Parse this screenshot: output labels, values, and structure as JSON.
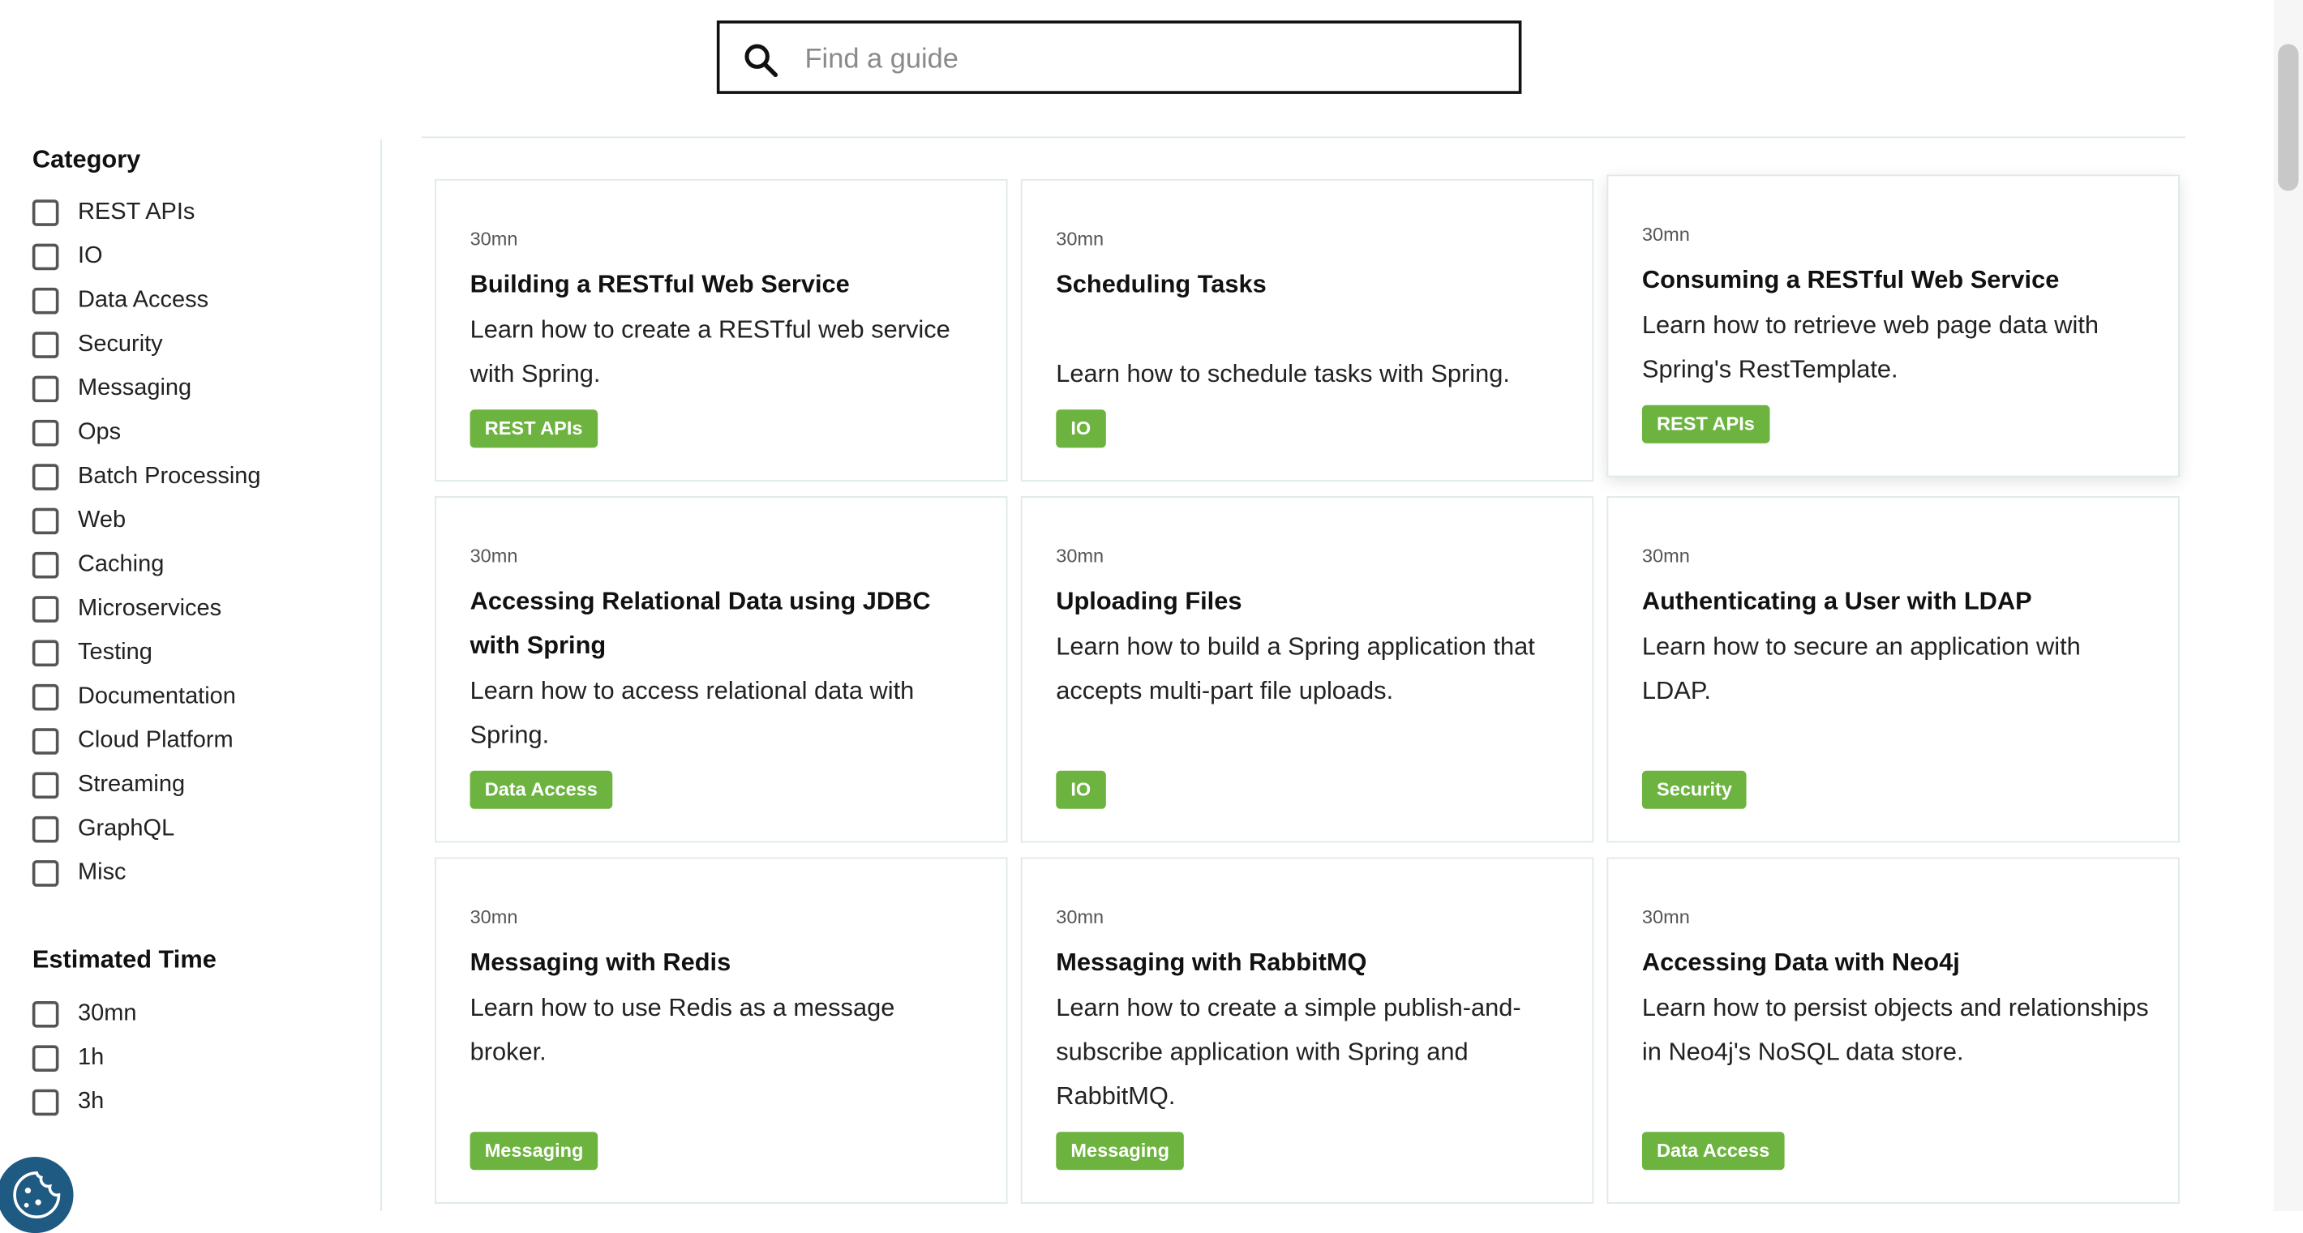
{
  "search": {
    "placeholder": "Find a guide"
  },
  "filters": {
    "category_title": "Category",
    "categories": [
      "REST APIs",
      "IO",
      "Data Access",
      "Security",
      "Messaging",
      "Ops",
      "Batch Processing",
      "Web",
      "Caching",
      "Microservices",
      "Testing",
      "Documentation",
      "Cloud Platform",
      "Streaming",
      "GraphQL",
      "Misc"
    ],
    "time_title": "Estimated Time",
    "times": [
      "30mn",
      "1h",
      "3h"
    ]
  },
  "cards": [
    {
      "time": "30mn",
      "title": "Building a RESTful Web Service",
      "desc": "Learn how to create a RESTful web service with Spring.",
      "tag": "REST APIs"
    },
    {
      "time": "30mn",
      "title": "Scheduling Tasks",
      "desc": "Learn how to schedule tasks with Spring.",
      "tag": "IO"
    },
    {
      "time": "30mn",
      "title": "Consuming a RESTful Web Service",
      "desc": "Learn how to retrieve web page data with Spring's RestTemplate.",
      "tag": "REST APIs"
    },
    {
      "time": "30mn",
      "title": "Accessing Relational Data using JDBC with Spring",
      "desc": "Learn how to access relational data with Spring.",
      "tag": "Data Access"
    },
    {
      "time": "30mn",
      "title": "Uploading Files",
      "desc": "Learn how to build a Spring application that accepts multi-part file uploads.",
      "tag": "IO"
    },
    {
      "time": "30mn",
      "title": "Authenticating a User with LDAP",
      "desc": "Learn how to secure an application with LDAP.",
      "tag": "Security"
    },
    {
      "time": "30mn",
      "title": "Messaging with Redis",
      "desc": "Learn how to use Redis as a message broker.",
      "tag": "Messaging"
    },
    {
      "time": "30mn",
      "title": "Messaging with RabbitMQ",
      "desc": "Learn how to create a simple publish-and-subscribe application with Spring and RabbitMQ.",
      "tag": "Messaging"
    },
    {
      "time": "30mn",
      "title": "Accessing Data with Neo4j",
      "desc": "Learn how to persist objects and relationships in Neo4j's NoSQL data store.",
      "tag": "Data Access"
    }
  ],
  "colors": {
    "tag_green": "#6db33f",
    "cookie_blue": "#1e5a82",
    "heading_accent": "#c6786f"
  },
  "icons": {
    "search": "search-icon",
    "cookie": "cookie-icon"
  }
}
